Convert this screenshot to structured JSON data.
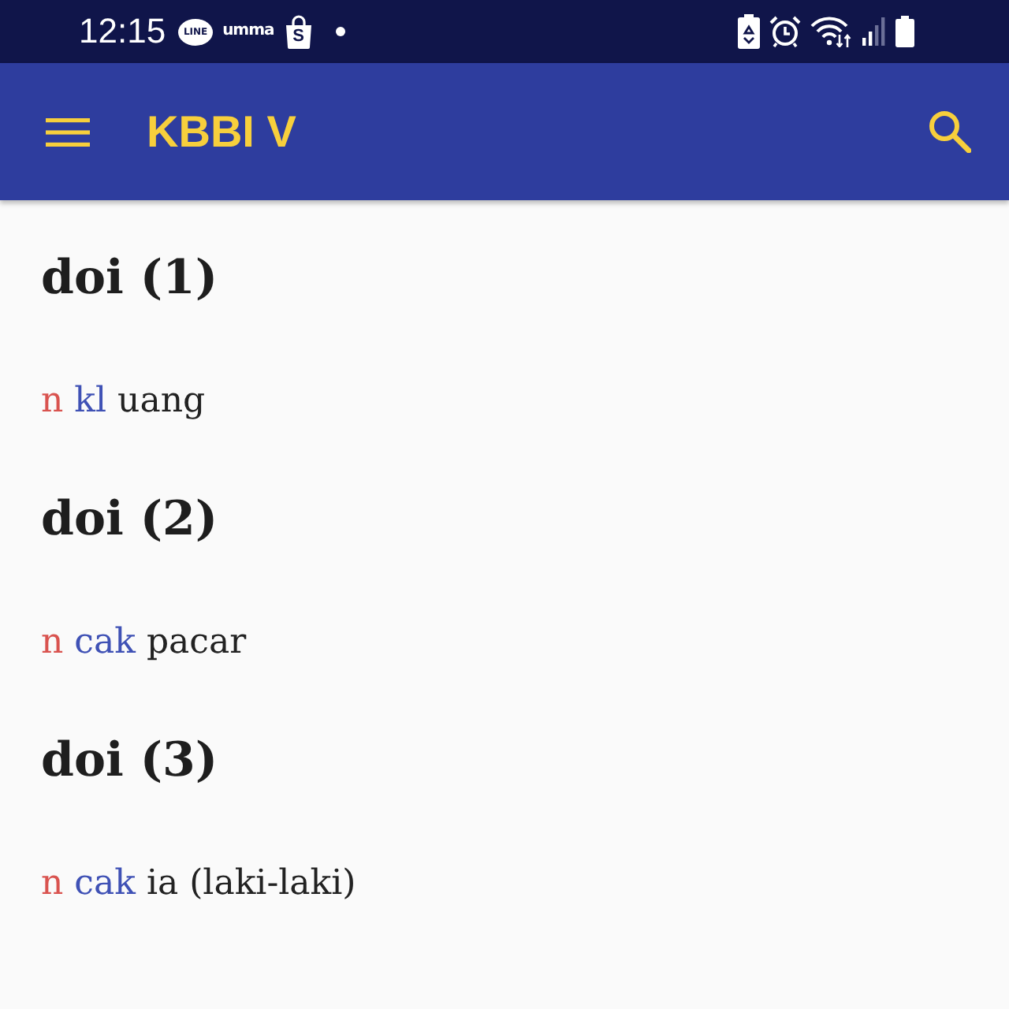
{
  "status_bar": {
    "time": "12:15",
    "notification_logos": [
      {
        "kind": "bubble",
        "text": "LINE"
      },
      {
        "kind": "wordmark",
        "text": "umma"
      },
      {
        "kind": "bag",
        "text": "S"
      }
    ]
  },
  "app_bar": {
    "title": "KBBI V"
  },
  "entries": [
    {
      "headword": "doi (1)",
      "definition": [
        {
          "kind": "class",
          "text": "n"
        },
        {
          "kind": "label",
          "text": "kl"
        },
        {
          "kind": "meaning",
          "text": "uang"
        }
      ]
    },
    {
      "headword": "doi (2)",
      "definition": [
        {
          "kind": "class",
          "text": "n"
        },
        {
          "kind": "label",
          "text": "cak"
        },
        {
          "kind": "meaning",
          "text": "pacar"
        }
      ]
    },
    {
      "headword": "doi (3)",
      "definition": [
        {
          "kind": "class",
          "text": "n"
        },
        {
          "kind": "label",
          "text": "cak"
        },
        {
          "kind": "meaning",
          "text": "ia (laki-laki)"
        }
      ]
    }
  ]
}
